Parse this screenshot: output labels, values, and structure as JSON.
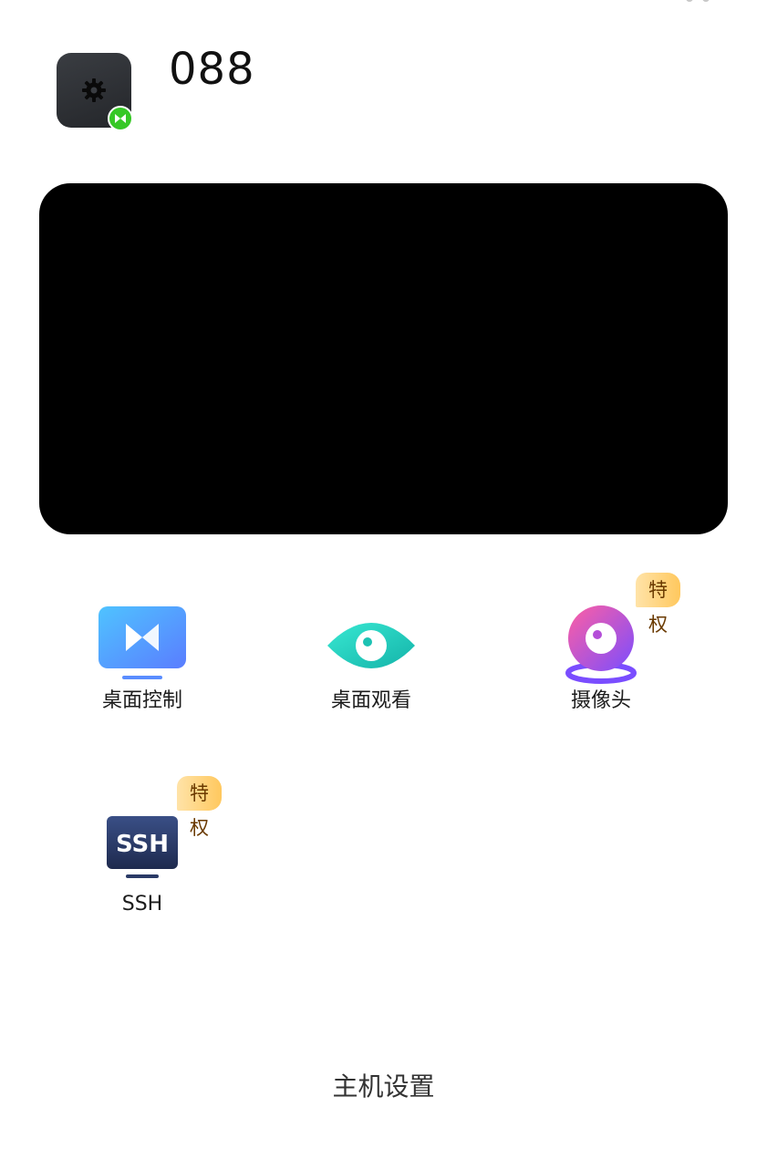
{
  "device": {
    "name": "088",
    "icon": "gear-icon",
    "status_badge_icon": "remote-control-icon",
    "status_color": "#36c826"
  },
  "preview": {
    "background": "#000000"
  },
  "features": [
    {
      "id": "desktop-control",
      "label": "桌面控制",
      "icon": "remote-desktop-icon",
      "badge": ""
    },
    {
      "id": "desktop-view",
      "label": "桌面观看",
      "icon": "eye-icon",
      "badge": ""
    },
    {
      "id": "camera",
      "label": "摄像头",
      "icon": "camera-icon",
      "badge": "特权"
    },
    {
      "id": "ssh",
      "label": "SSH",
      "icon": "ssh-terminal-icon",
      "badge": "特权",
      "icon_text": "SSH"
    }
  ],
  "footer": {
    "settings_label": "主机设置"
  },
  "colors": {
    "badge_text": "#6a3a00",
    "badge_bg_start": "#ffe3a8",
    "badge_bg_end": "#ffc85e"
  }
}
